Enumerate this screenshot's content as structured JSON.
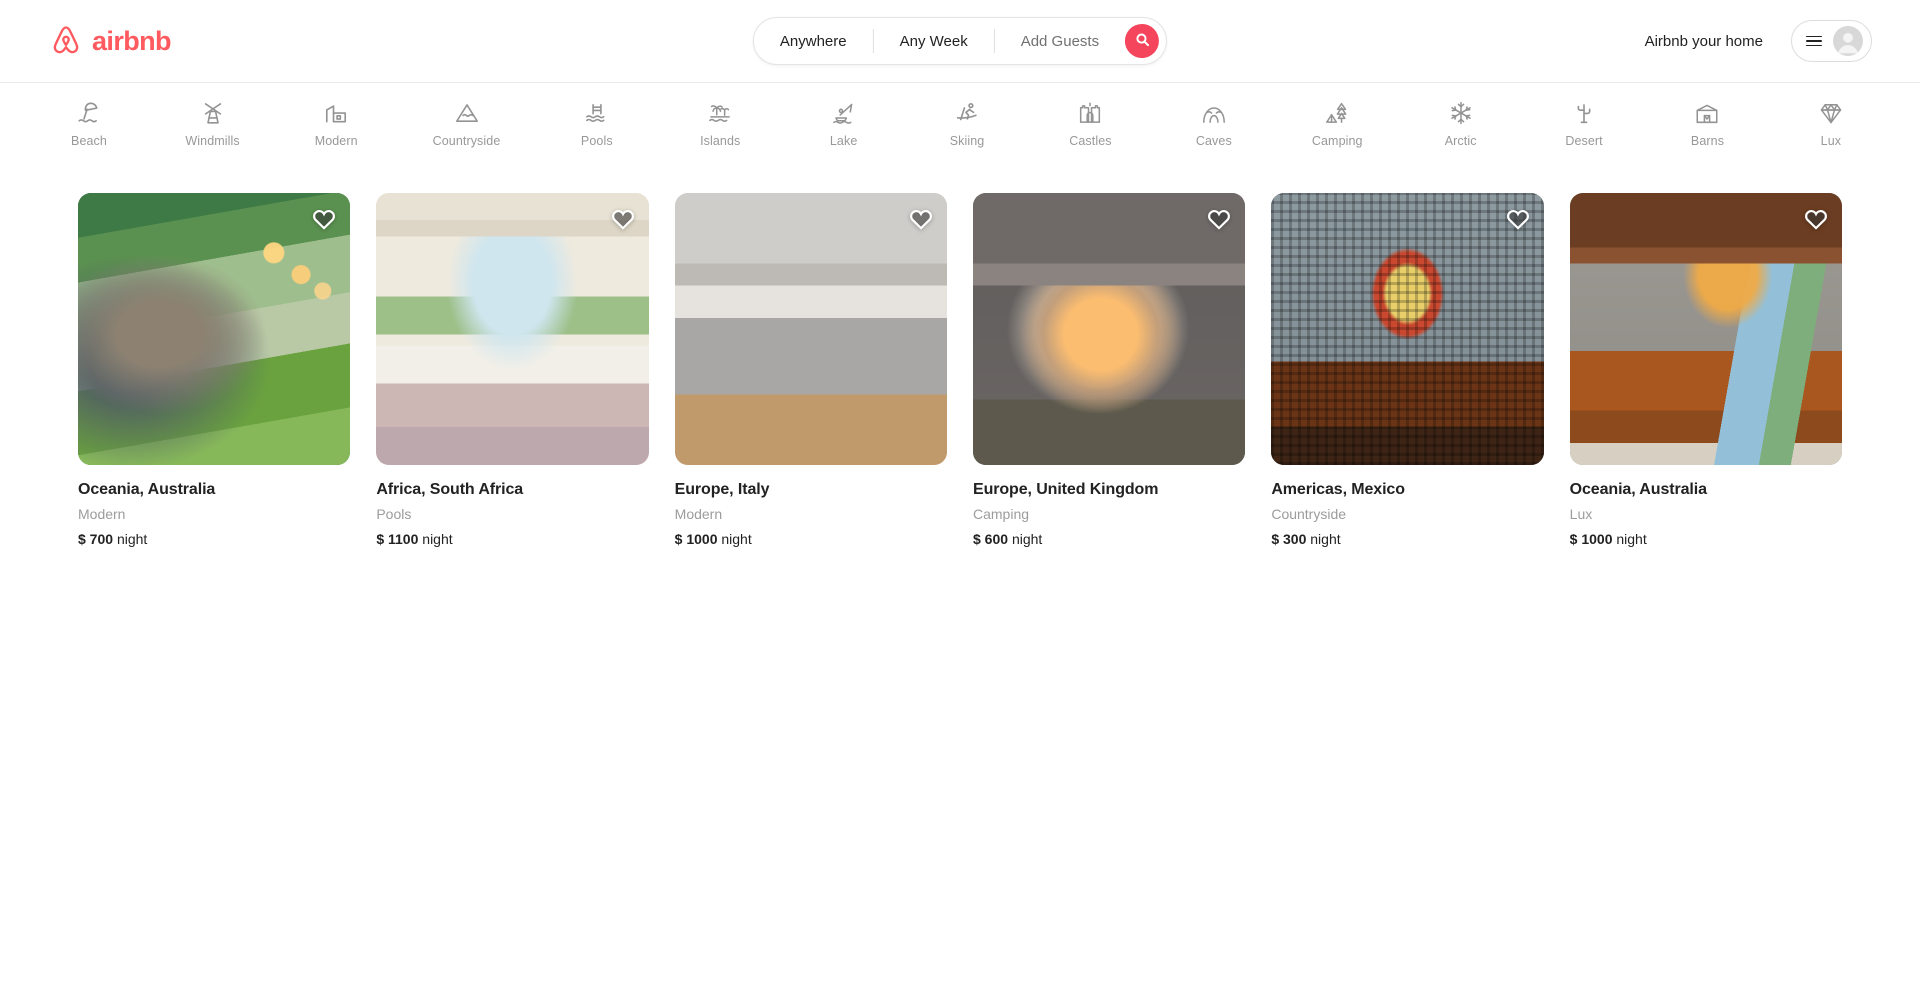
{
  "brand": {
    "name": "airbnb",
    "accent_color": "#ff5a5f",
    "search_button_color": "#f4455c"
  },
  "header": {
    "logo_label": "airbnb",
    "search": {
      "location_label": "Anywhere",
      "dates_label": "Any Week",
      "guests_label": "Add Guests",
      "search_icon": "search-icon"
    },
    "host_link_label": "Airbnb your home",
    "menu_icon": "hamburger-menu-icon",
    "avatar_icon": "user-avatar-icon"
  },
  "categories": [
    {
      "label": "Beach",
      "icon": "beach-umbrella-icon"
    },
    {
      "label": "Windmills",
      "icon": "windmill-icon"
    },
    {
      "label": "Modern",
      "icon": "modern-building-icon"
    },
    {
      "label": "Countryside",
      "icon": "mountain-icon"
    },
    {
      "label": "Pools",
      "icon": "pool-ladder-icon"
    },
    {
      "label": "Islands",
      "icon": "palm-island-icon"
    },
    {
      "label": "Lake",
      "icon": "fishing-boat-icon"
    },
    {
      "label": "Skiing",
      "icon": "skier-icon"
    },
    {
      "label": "Castles",
      "icon": "castle-icon"
    },
    {
      "label": "Caves",
      "icon": "cave-icon"
    },
    {
      "label": "Camping",
      "icon": "tent-tree-icon"
    },
    {
      "label": "Arctic",
      "icon": "snowflake-icon"
    },
    {
      "label": "Desert",
      "icon": "cactus-icon"
    },
    {
      "label": "Barns",
      "icon": "barn-icon"
    },
    {
      "label": "Lux",
      "icon": "diamond-icon"
    }
  ],
  "listings": [
    {
      "title": "Oceania, Australia",
      "category": "Modern",
      "price_amount": "$ 700",
      "price_unit": "night",
      "favorite_icon": "heart-icon",
      "photo": "ph-jungle"
    },
    {
      "title": "Africa, South Africa",
      "category": "Pools",
      "price_amount": "$ 1100",
      "price_unit": "night",
      "favorite_icon": "heart-icon",
      "photo": "ph-beachhouse"
    },
    {
      "title": "Europe, Italy",
      "category": "Modern",
      "price_amount": "$ 1000",
      "price_unit": "night",
      "favorite_icon": "heart-icon",
      "photo": "ph-loft"
    },
    {
      "title": "Europe, United Kingdom",
      "category": "Camping",
      "price_amount": "$ 600",
      "price_unit": "night",
      "favorite_icon": "heart-icon",
      "photo": "ph-pod"
    },
    {
      "title": "Americas, Mexico",
      "category": "Countryside",
      "price_amount": "$ 300",
      "price_unit": "night",
      "favorite_icon": "heart-icon",
      "photo": "ph-mexico"
    },
    {
      "title": "Oceania, Australia",
      "category": "Lux",
      "price_amount": "$ 1000",
      "price_unit": "night",
      "favorite_icon": "heart-icon",
      "photo": "ph-lux"
    }
  ]
}
